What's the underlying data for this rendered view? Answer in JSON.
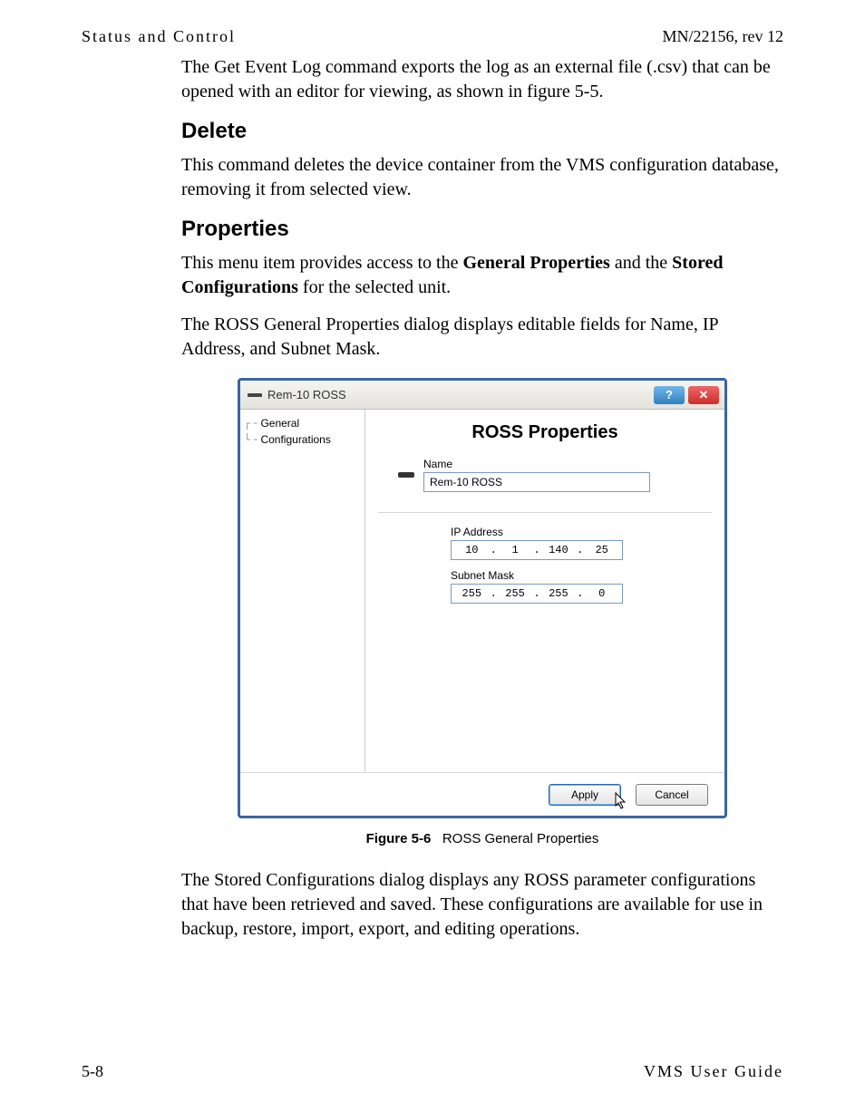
{
  "header": {
    "left": "Status and Control",
    "right": "MN/22156, rev 12"
  },
  "intro_paragraph": "The Get Event Log command exports the log as an external file (.csv) that can be opened with an editor for viewing, as shown in figure 5-5.",
  "sections": {
    "delete": {
      "heading": "Delete",
      "body": "This command deletes the device container from the VMS configuration database, removing it from selected view."
    },
    "properties": {
      "heading": "Properties",
      "p1_pre": "This menu item provides access to the ",
      "p1_b1": "General Properties",
      "p1_mid": " and the ",
      "p1_b2": "Stored Configurations",
      "p1_post": " for the selected unit.",
      "p2": "The ROSS General Properties dialog displays editable fields for Name, IP Address, and Subnet Mask."
    }
  },
  "dialog": {
    "title": "Rem-10 ROSS",
    "help_glyph": "?",
    "close_glyph": "✕",
    "tree": {
      "item1": "General",
      "item2": "Configurations"
    },
    "pane_title": "ROSS Properties",
    "name_label": "Name",
    "name_value": "Rem-10 ROSS",
    "ip_label": "IP Address",
    "ip": {
      "a": "10",
      "b": "1",
      "c": "140",
      "d": "25"
    },
    "mask_label": "Subnet Mask",
    "mask": {
      "a": "255",
      "b": "255",
      "c": "255",
      "d": "0"
    },
    "apply": "Apply",
    "cancel": "Cancel"
  },
  "figure": {
    "label": "Figure 5-6",
    "caption": "ROSS General Properties"
  },
  "after_figure": "The Stored Configurations dialog displays any ROSS parameter configurations that have been retrieved and saved. These configurations are available for use in backup, restore, import, export, and editing operations.",
  "footer": {
    "left": "5-8",
    "right": "VMS User Guide"
  }
}
